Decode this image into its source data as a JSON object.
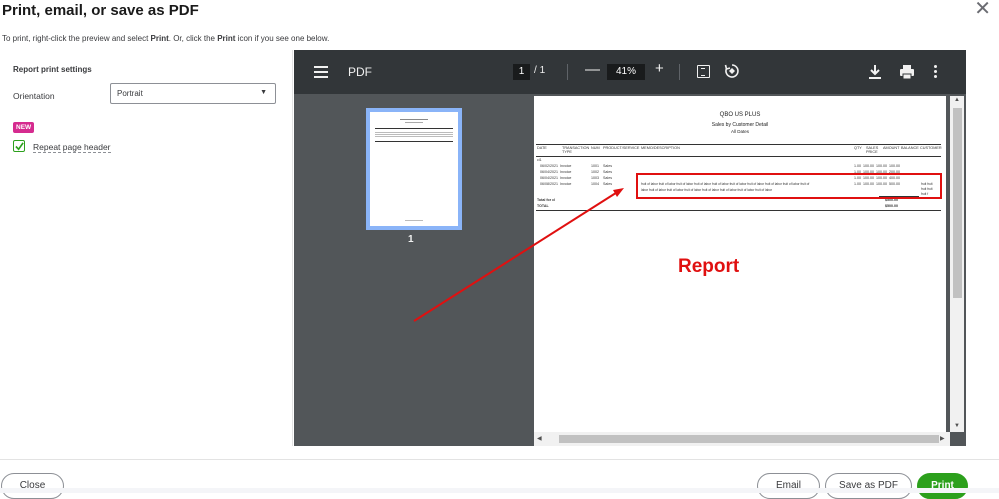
{
  "dialog": {
    "title": "Print, email, or save as PDF",
    "instructions_pre": "To print, right-click the preview and select ",
    "instructions_print1": "Print",
    "instructions_mid": ". Or, click the ",
    "instructions_print2": "Print",
    "instructions_post": " icon if you see one below."
  },
  "settings": {
    "title": "Report print settings",
    "orientation_label": "Orientation",
    "orientation_value": "Portrait",
    "new_badge": "NEW",
    "repeat_header_label": "Repeat page header",
    "repeat_header_checked": true
  },
  "viewer": {
    "doc_label": "PDF",
    "page_current": "1",
    "page_sep": "/",
    "page_total": "1",
    "zoom": "41%",
    "minus": "—",
    "plus": "+",
    "thumb_page": "1"
  },
  "report": {
    "company": "QBO US PLUS",
    "title": "Sales by Customer Detail",
    "subtitle": "All Dates",
    "columns": [
      "DATE",
      "TRANSACTION TYPE",
      "NUM",
      "PRODUCT/SERVICE",
      "MEMO/DESCRIPTION",
      "QTY",
      "SALES PRICE",
      "AMOUNT",
      "BALANCE",
      "CUSTOMER"
    ],
    "group": "cl1",
    "rows": [
      {
        "date": "06/02/2021",
        "type": "Invoice",
        "num": "1001",
        "product": "Sales",
        "memo": "",
        "qty": "1.00",
        "price": "100.00",
        "amount": "100.00",
        "balance": "100.00",
        "customer": ""
      },
      {
        "date": "06/04/2021",
        "type": "Invoice",
        "num": "1002",
        "product": "Sales",
        "memo": "",
        "qty": "1.00",
        "price": "100.00",
        "amount": "100.00",
        "balance": "200.00",
        "customer": ""
      },
      {
        "date": "06/04/2021",
        "type": "Invoice",
        "num": "1003",
        "product": "Sales",
        "memo": "",
        "qty": "1.00",
        "price": "100.00",
        "amount": "100.00",
        "balance": "400.00",
        "customer": ""
      },
      {
        "date": "06/08/2021",
        "type": "Invoice",
        "num": "1004",
        "product": "Sales",
        "memo": "fruit of labor fruit of labor fruit of labor fruit of labor fruit of labor fruit of labor fruit of labor fruit of labor fruit of labor fruit of",
        "memo2": "labor fruit of labor fruit of labor fruit of labor fruit of labor fruit of labor fruit of labor fruit of labor",
        "qty": "1.00",
        "price": "100.00",
        "amount": "100.00",
        "balance": "500.00",
        "customer": "fruit fruit",
        "customer2": "fruit fruit",
        "customer3": "fruit f"
      }
    ],
    "total_label": "Total for cl",
    "total_grand": "TOTAL",
    "total_value": "$500.00",
    "grand_value": "$500.00"
  },
  "annotation": {
    "label": "Report",
    "color": "#e01010"
  },
  "footer": {
    "close": "Close",
    "email": "Email",
    "save_pdf": "Save as PDF",
    "print": "Print"
  }
}
